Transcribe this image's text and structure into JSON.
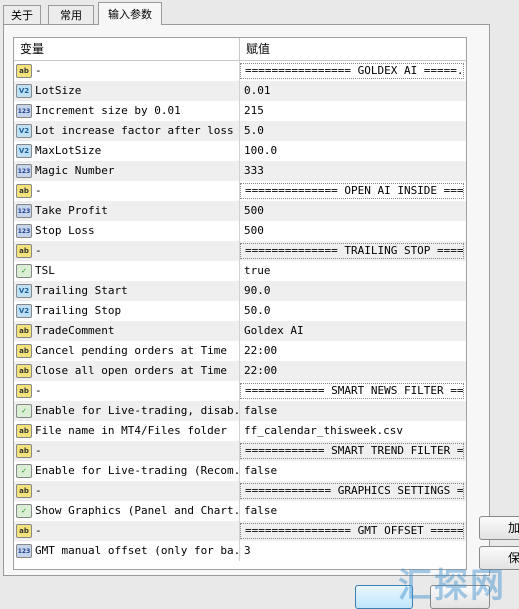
{
  "tabs": [
    {
      "label": "关于"
    },
    {
      "label": "常用"
    },
    {
      "label": "输入参数"
    }
  ],
  "grid": {
    "col_variable": "变量",
    "col_value": "赋值",
    "rows": [
      {
        "icon": "ab",
        "name": "-",
        "value": "================ GOLDEX AI =====...",
        "sep": true
      },
      {
        "icon": "v2",
        "name": "LotSize",
        "value": "0.01"
      },
      {
        "icon": "123",
        "name": "Increment size by 0.01",
        "value": "215"
      },
      {
        "icon": "v2",
        "name": "Lot increase factor after loss",
        "value": "5.0"
      },
      {
        "icon": "v2",
        "name": "MaxLotSize",
        "value": "100.0"
      },
      {
        "icon": "123",
        "name": "Magic Number",
        "value": "333"
      },
      {
        "icon": "ab",
        "name": "-",
        "value": "============== OPEN AI INSIDE ===...",
        "sep": true
      },
      {
        "icon": "123",
        "name": "Take Profit",
        "value": "500"
      },
      {
        "icon": "123",
        "name": "Stop Loss",
        "value": "500"
      },
      {
        "icon": "ab",
        "name": "-",
        "value": "============== TRAILING STOP ====...",
        "sep": true
      },
      {
        "icon": "bool",
        "name": "TSL",
        "value": "true"
      },
      {
        "icon": "v2",
        "name": "Trailing Start",
        "value": "90.0"
      },
      {
        "icon": "v2",
        "name": "Trailing Stop",
        "value": "50.0"
      },
      {
        "icon": "ab",
        "name": "TradeComment",
        "value": "Goldex AI"
      },
      {
        "icon": "ab",
        "name": "Cancel pending orders at Time",
        "value": "22:00"
      },
      {
        "icon": "ab",
        "name": "Close all open orders at Time",
        "value": "22:00"
      },
      {
        "icon": "ab",
        "name": "-",
        "value": "============ SMART NEWS FILTER ==...",
        "sep": true
      },
      {
        "icon": "bool",
        "name": "Enable for Live-trading, disab...",
        "value": "false"
      },
      {
        "icon": "ab",
        "name": "File name in MT4/Files folder",
        "value": "ff_calendar_thisweek.csv"
      },
      {
        "icon": "ab",
        "name": "-",
        "value": "============ SMART TREND FILTER =...",
        "sep": true
      },
      {
        "icon": "bool",
        "name": "Enable for Live-trading (Recom...",
        "value": "false"
      },
      {
        "icon": "ab",
        "name": "-",
        "value": "============= GRAPHICS SETTINGS =...",
        "sep": true
      },
      {
        "icon": "bool",
        "name": "Show Graphics (Panel and Chart...",
        "value": "false"
      },
      {
        "icon": "ab",
        "name": "-",
        "value": "================ GMT OFFSET =====...",
        "sep": true
      },
      {
        "icon": "123",
        "name": "GMT manual offset (only for ba...",
        "value": "3"
      }
    ]
  },
  "icon_labels": {
    "ab": "ab",
    "v2": "V2",
    "123": "123",
    "bool": "✓"
  },
  "side_buttons": [
    {
      "label": "加"
    },
    {
      "label": "保"
    }
  ],
  "watermark": "汇探网"
}
